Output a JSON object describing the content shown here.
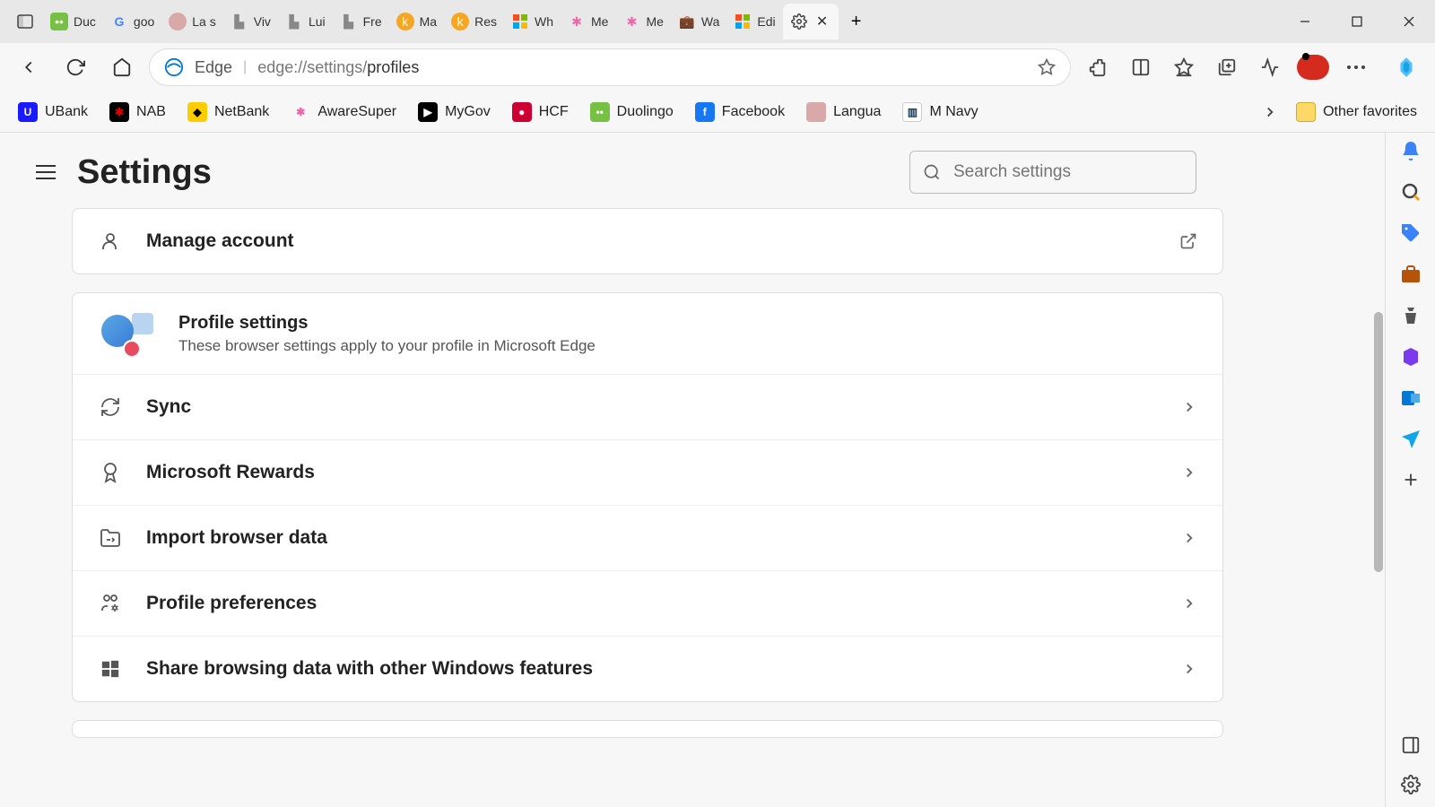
{
  "tabs": [
    {
      "label": "Duc",
      "icon_bg": "#76c043",
      "icon_txt": "••"
    },
    {
      "label": "goo",
      "icon_bg": "#fff",
      "icon_txt": "G"
    },
    {
      "label": "La s",
      "icon_bg": "#d9a9a9",
      "icon_txt": "▬"
    },
    {
      "label": "Viv",
      "icon_bg": "#888",
      "icon_txt": "▙"
    },
    {
      "label": "Lui",
      "icon_bg": "#888",
      "icon_txt": "▙"
    },
    {
      "label": "Fre",
      "icon_bg": "#888",
      "icon_txt": "▙"
    },
    {
      "label": "Ma",
      "icon_bg": "#f5a623",
      "icon_txt": "k"
    },
    {
      "label": "Res",
      "icon_bg": "#f5a623",
      "icon_txt": "k"
    },
    {
      "label": "Wh",
      "icon_bg": "",
      "icon_txt": "▦"
    },
    {
      "label": "Me",
      "icon_bg": "",
      "icon_txt": "✱"
    },
    {
      "label": "Me",
      "icon_bg": "",
      "icon_txt": "✱"
    },
    {
      "label": "Wa",
      "icon_bg": "#555",
      "icon_txt": "💼"
    },
    {
      "label": "Edi",
      "icon_bg": "",
      "icon_txt": "▦"
    }
  ],
  "active_tab_close": "✕",
  "address": {
    "prefix": "Edge",
    "url_grey": "edge://settings/",
    "url_dark": "profiles"
  },
  "favorites": [
    {
      "label": "UBank",
      "bg": "#1a1aff",
      "txt": "U"
    },
    {
      "label": "NAB",
      "bg": "#000",
      "txt": "✱"
    },
    {
      "label": "NetBank",
      "bg": "#ffcc00",
      "txt": "◆"
    },
    {
      "label": "AwareSuper",
      "bg": "#fff",
      "txt": "✱"
    },
    {
      "label": "MyGov",
      "bg": "#000",
      "txt": "▶"
    },
    {
      "label": "HCF",
      "bg": "#cc0033",
      "txt": "●"
    },
    {
      "label": "Duolingo",
      "bg": "#76c043",
      "txt": "••"
    },
    {
      "label": "Facebook",
      "bg": "#1877f2",
      "txt": "f"
    },
    {
      "label": "Langua",
      "bg": "#e8e8e8",
      "txt": "▬"
    },
    {
      "label": "M Navy",
      "bg": "#fff",
      "txt": "▥"
    }
  ],
  "other_favorites": "Other favorites",
  "settings": {
    "title": "Settings",
    "search_placeholder": "Search settings",
    "manage_account": "Manage account",
    "profile_settings_title": "Profile settings",
    "profile_settings_desc": "These browser settings apply to your profile in Microsoft Edge",
    "rows": {
      "sync": "Sync",
      "rewards": "Microsoft Rewards",
      "import": "Import browser data",
      "prefs": "Profile preferences",
      "share": "Share browsing data with other Windows features"
    }
  }
}
